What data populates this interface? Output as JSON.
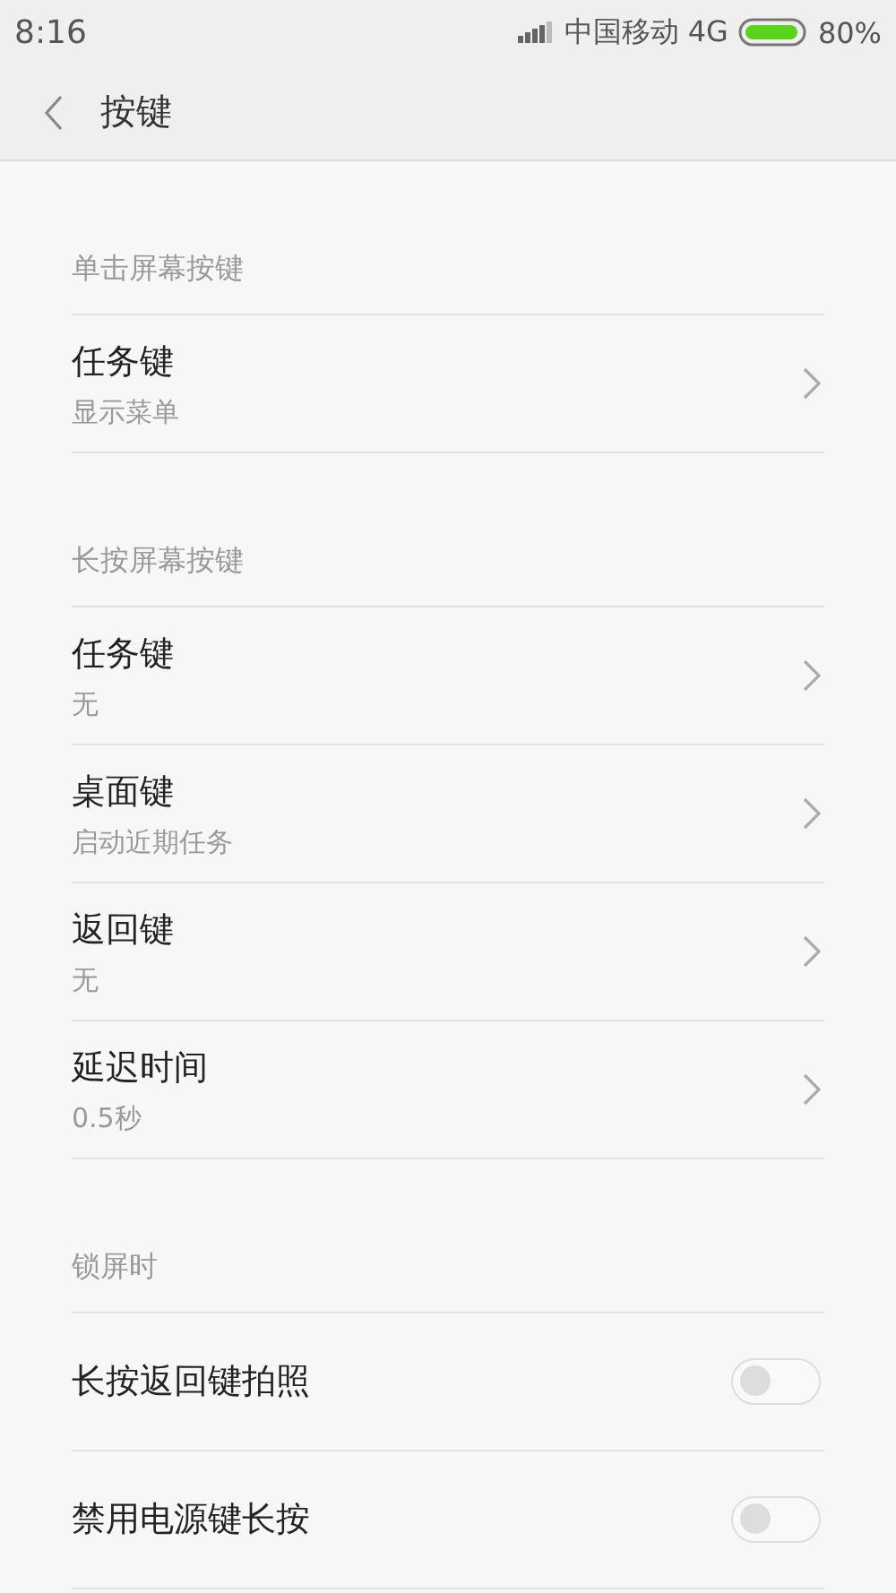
{
  "status_bar": {
    "time": "8:16",
    "carrier": "中国移动 4G",
    "battery": "80%"
  },
  "header": {
    "title": "按键"
  },
  "sections": [
    {
      "title": "单击屏幕按键",
      "items": [
        {
          "kind": "link",
          "label": "任务键",
          "value": "显示菜单"
        }
      ]
    },
    {
      "title": "长按屏幕按键",
      "items": [
        {
          "kind": "link",
          "label": "任务键",
          "value": "无"
        },
        {
          "kind": "link",
          "label": "桌面键",
          "value": "启动近期任务"
        },
        {
          "kind": "link",
          "label": "返回键",
          "value": "无"
        },
        {
          "kind": "link",
          "label": "延迟时间",
          "value": "0.5秒"
        }
      ]
    },
    {
      "title": "锁屏时",
      "items": [
        {
          "kind": "toggle",
          "label": "长按返回键拍照",
          "on": false
        },
        {
          "kind": "toggle",
          "label": "禁用电源键长按",
          "on": false
        }
      ]
    }
  ]
}
